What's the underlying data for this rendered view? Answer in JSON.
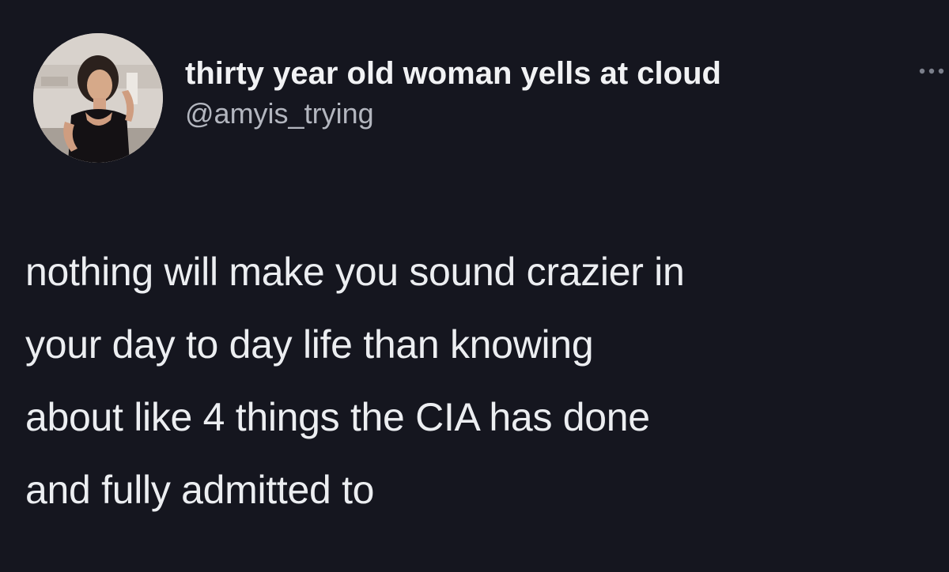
{
  "author": {
    "display_name": "thirty year old woman yells at cloud",
    "handle": "@amyis_trying"
  },
  "tweet": {
    "text": "nothing will make you sound crazier in\nyour day to day life than knowing\nabout like 4 things the CIA has done\nand fully admitted to"
  },
  "icons": {
    "avatar": "profile-photo",
    "more": "more-options-icon"
  },
  "colors": {
    "background": "#15161f",
    "text": "#eceef1",
    "handle": "#b3b6bf"
  }
}
